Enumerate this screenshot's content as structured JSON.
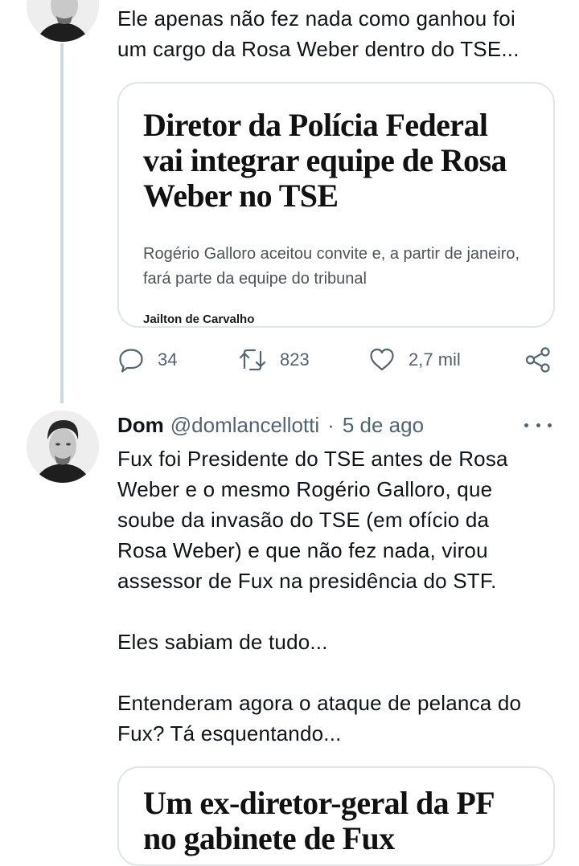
{
  "tweet1": {
    "text": "Ele apenas não fez nada como ganhou foi\num cargo da Rosa Weber dentro do TSE...",
    "card": {
      "headline": "Diretor da Polícia Federal vai integrar equipe de Rosa Weber no TSE",
      "subtitle": "Rogério Galloro aceitou convite e, a partir de janeiro, fará parte da equipe do tribunal",
      "author": "Jailton de Carvalho"
    },
    "actions": {
      "replies": "34",
      "retweets": "823",
      "likes": "2,7 mil"
    }
  },
  "tweet2": {
    "name": "Dom",
    "handle": "@domlancellotti",
    "separator": "·",
    "date": "5 de ago",
    "text": "Fux foi Presidente do TSE antes de Rosa\nWeber e o mesmo Rogério Galloro, que\nsoube da invasão do TSE (em ofício da\nRosa Weber) e que não fez nada, virou\nassessor de Fux na presidência do STF.\n\nEles sabiam de tudo...\n\nEntenderam agora o ataque de pelanca do\nFux? Tá esquentando...",
    "card": {
      "headline": "Um ex-diretor-geral da PF no gabinete de Fux"
    }
  },
  "icons": {
    "reply": "reply-icon",
    "retweet": "retweet-icon",
    "like": "heart-icon",
    "share": "share-icon",
    "more": "more-options-icon"
  },
  "colors": {
    "secondary_text": "#536471",
    "thread_line": "#cfd9de",
    "card_border": "#dfe5e8"
  }
}
